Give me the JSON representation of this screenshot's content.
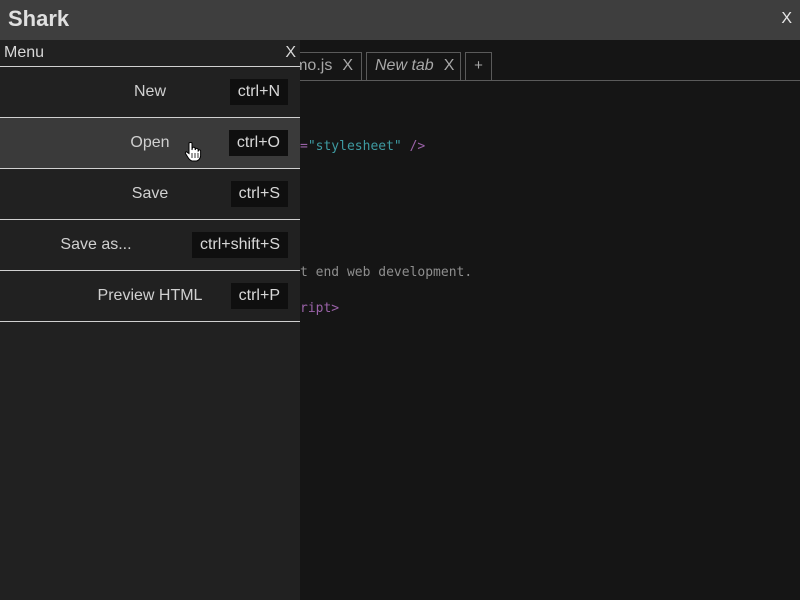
{
  "app": {
    "title": "Shark",
    "close_label": "X"
  },
  "tabs": {
    "items": [
      {
        "label": "mo.js",
        "close": "X"
      },
      {
        "label": "New tab",
        "close": "X"
      }
    ],
    "add_label": "+"
  },
  "editor": {
    "lines": [
      {
        "text": "=",
        "string": "\"stylesheet\"",
        "tail": " />"
      },
      {
        "text": "t end web development."
      },
      {
        "text": "ript>"
      }
    ]
  },
  "menu": {
    "title": "Menu",
    "close_label": "X",
    "hovered_item": "Open",
    "items": [
      {
        "label": "New",
        "shortcut": "ctrl+N"
      },
      {
        "label": "Open",
        "shortcut": "ctrl+O"
      },
      {
        "label": "Save",
        "shortcut": "ctrl+S"
      },
      {
        "label": "Save as...",
        "shortcut": "ctrl+shift+S"
      },
      {
        "label": "Preview HTML",
        "shortcut": "ctrl+P"
      }
    ]
  },
  "colors": {
    "titlebar_bg": "#3e3e3e",
    "editor_bg": "#151515",
    "menu_bg": "#212121",
    "menu_hover_bg": "#3a3a3a",
    "string_token": "#3e9aa1",
    "tag_token": "#9a62a8"
  },
  "icons": {
    "pointer": "hand-pointer-icon"
  }
}
